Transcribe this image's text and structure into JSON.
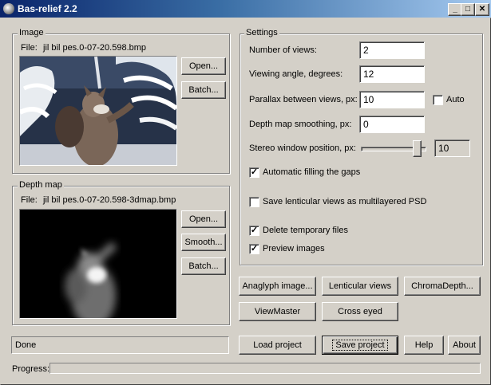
{
  "window": {
    "title": "Bas-relief 2.2",
    "min_glyph": "_",
    "max_glyph": "□",
    "close_glyph": "✕"
  },
  "image_group": {
    "label": "Image",
    "file_label": "File:",
    "file_name": "jil bil pes.0-07-20.598.bmp",
    "open_button": "Open...",
    "batch_button": "Batch..."
  },
  "depth_group": {
    "label": "Depth map",
    "file_label": "File:",
    "file_name": "jil bil pes.0-07-20.598-3dmap.bmp",
    "open_button": "Open...",
    "smooth_button": "Smooth...",
    "batch_button": "Batch..."
  },
  "settings": {
    "label": "Settings",
    "number_of_views_label": "Number of views:",
    "number_of_views": "2",
    "viewing_angle_label": "Viewing angle, degrees:",
    "viewing_angle": "12",
    "parallax_label": "Parallax between views, px:",
    "parallax": "10",
    "auto_label": "Auto",
    "auto_checked": false,
    "smoothing_label": "Depth map smoothing, px:",
    "smoothing": "0",
    "stereo_window_label": "Stereo window position, px:",
    "stereo_window_value": "10",
    "slider_fraction": 0.92,
    "auto_fill_label": "Automatic filling the gaps",
    "auto_fill_checked": true,
    "save_psd_label": "Save lenticular views as multilayered PSD",
    "save_psd_checked": false,
    "delete_temp_label": "Delete temporary files",
    "delete_temp_checked": true,
    "preview_label": "Preview images",
    "preview_checked": true
  },
  "actions": {
    "anaglyph": "Anaglyph image...",
    "lenticular": "Lenticular views",
    "chromadepth": "ChromaDepth...",
    "viewmaster": "ViewMaster",
    "cross_eyed": "Cross eyed"
  },
  "bottom": {
    "status": "Done",
    "load_project": "Load project",
    "save_project": "Save project",
    "help": "Help",
    "about": "About",
    "progress_label": "Progress:"
  },
  "icons": {
    "check": "✓",
    "app": "app-icon"
  }
}
